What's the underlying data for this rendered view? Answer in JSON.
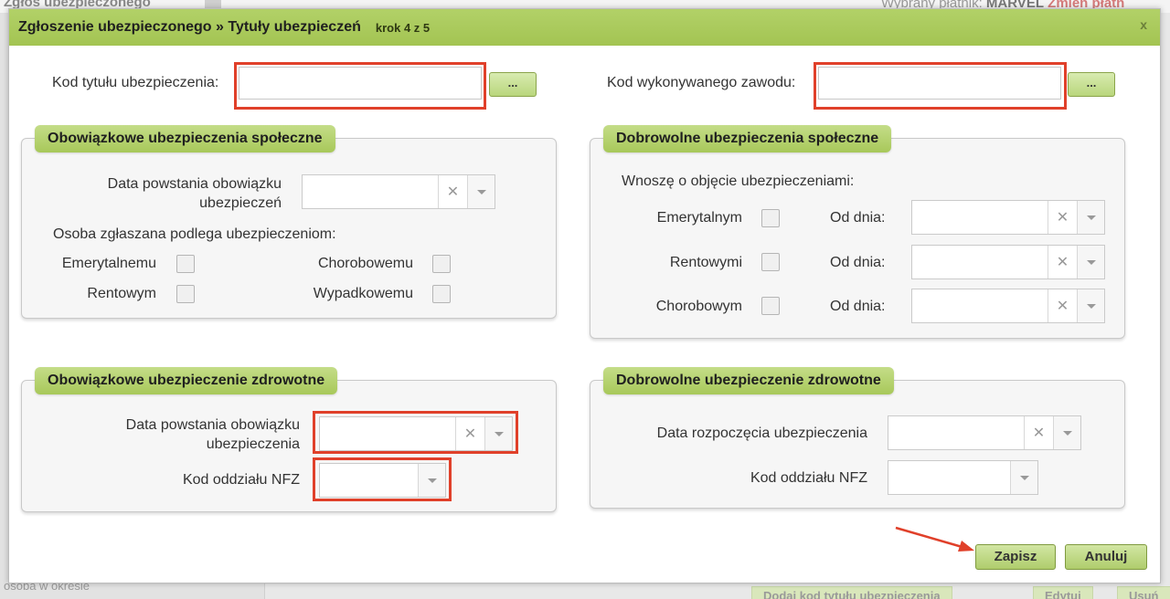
{
  "background": {
    "app_title": "Zgłoś ubezpieczonego",
    "payer_label": "Wybrany płatnik:",
    "payer_name": "MARVEL",
    "change_payer": "Zmień płatn",
    "left_footer": "osoba w okresie",
    "bottom_buttons": [
      "Dodaj kod tytułu ubezpieczenia",
      "Edytuj",
      "Usuń"
    ]
  },
  "modal": {
    "title": "Zgłoszenie ubezpieczonego » Tytuły ubezpieczeń",
    "step": "krok 4 z 5",
    "close": "x"
  },
  "top_fields": {
    "insurance_title_code_label": "Kod tytułu ubezpieczenia:",
    "insurance_title_code_value": "",
    "occupation_code_label": "Kod wykonywanego zawodu:",
    "occupation_code_value": "",
    "browse_label": "..."
  },
  "mandatory_social": {
    "title": "Obowiązkowe ubezpieczenia społeczne",
    "date_label_1": "Data powstania obowiązku",
    "date_label_2": "ubezpieczeń",
    "subject_label": "Osoba zgłaszana podlega ubezpieczeniom:",
    "checkboxes": {
      "emerytalnemu": "Emerytalnemu",
      "rentowym": "Rentowym",
      "chorobowemu": "Chorobowemu",
      "wypadkowemu": "Wypadkowemu"
    }
  },
  "voluntary_social": {
    "title": "Dobrowolne ubezpieczenia społeczne",
    "request_label": "Wnoszę o objęcie ubezpieczeniami:",
    "rows": [
      {
        "label": "Emerytalnym",
        "from_label": "Od dnia:"
      },
      {
        "label": "Rentowymi",
        "from_label": "Od dnia:"
      },
      {
        "label": "Chorobowym",
        "from_label": "Od dnia:"
      }
    ]
  },
  "mandatory_health": {
    "title": "Obowiązkowe ubezpieczenie zdrowotne",
    "date_label_1": "Data powstania obowiązku",
    "date_label_2": "ubezpieczenia",
    "nfz_label": "Kod oddziału NFZ"
  },
  "voluntary_health": {
    "title": "Dobrowolne ubezpieczenie zdrowotne",
    "date_label": "Data rozpoczęcia ubezpieczenia",
    "nfz_label": "Kod oddziału NFZ"
  },
  "actions": {
    "save": "Zapisz",
    "cancel": "Anuluj"
  },
  "colors": {
    "header_green": "#a9c95a",
    "highlight_red": "#e0402a"
  }
}
